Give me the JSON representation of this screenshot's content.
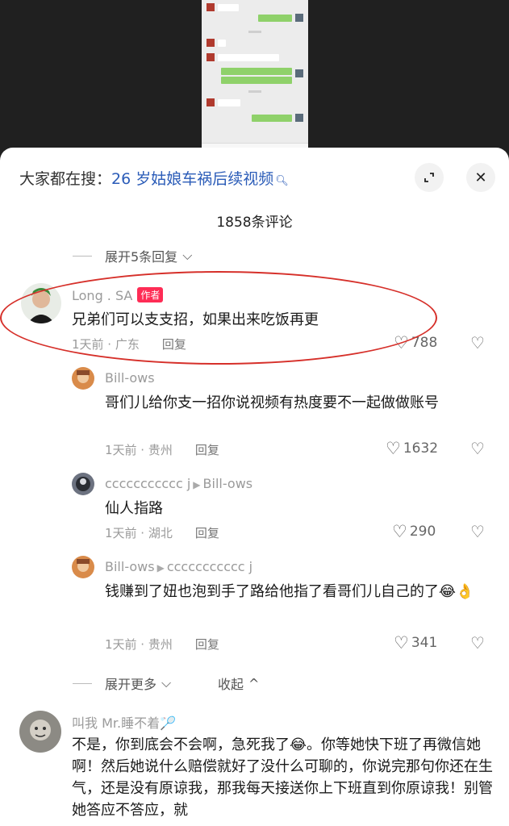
{
  "search": {
    "prefix": "大家都在搜：",
    "keyword": "26 岁姑娘车祸后续视频"
  },
  "comment_count": "1858条评论",
  "expand_top": "展开5条回复",
  "expand_more": "展开更多",
  "collapse": "收起",
  "icons": {
    "search": "search-icon",
    "expand": "expand-icon",
    "close": "close-icon",
    "like": "heart-icon",
    "dislike": "broken-heart-icon"
  },
  "comments": [
    {
      "user": "Long . SA",
      "tag": "作者",
      "text": "兄弟们可以支支招，如果出来吃饭再更",
      "time_loc": "1天前 · 广东",
      "reply": "回复",
      "likes": "788"
    },
    {
      "user": "Bill-ows",
      "text": "哥们儿给你支一招你说视频有热度要不一起做做账号",
      "time_loc": "1天前 · 贵州",
      "reply": "回复",
      "likes": "1632"
    },
    {
      "user": "ccccccccccc j",
      "reply_to": "Bill-ows",
      "text": "仙人指路",
      "time_loc": "1天前 · 湖北",
      "reply": "回复",
      "likes": "290"
    },
    {
      "user": "Bill-ows",
      "reply_to": "ccccccccccc j",
      "text": "钱赚到了妞也泡到手了路给他指了看哥们儿自己的了😂👌",
      "time_loc": "1天前 · 贵州",
      "reply": "回复",
      "likes": "341"
    },
    {
      "user": "叫我 Mr.睡不着🏸",
      "text": "不是，你到底会不会啊，急死我了😂。你等她快下班了再微信她啊！然后她说什么赔偿就好了没什么可聊的，你说完那句你还在生气，还是没有原谅我，那我每天接送你上下班直到你原谅我！别管她答应不答应，就"
    }
  ],
  "colors": {
    "accent_red": "#fe2c55",
    "link_blue": "#2b5cb8",
    "circle_red": "#d6302a"
  }
}
